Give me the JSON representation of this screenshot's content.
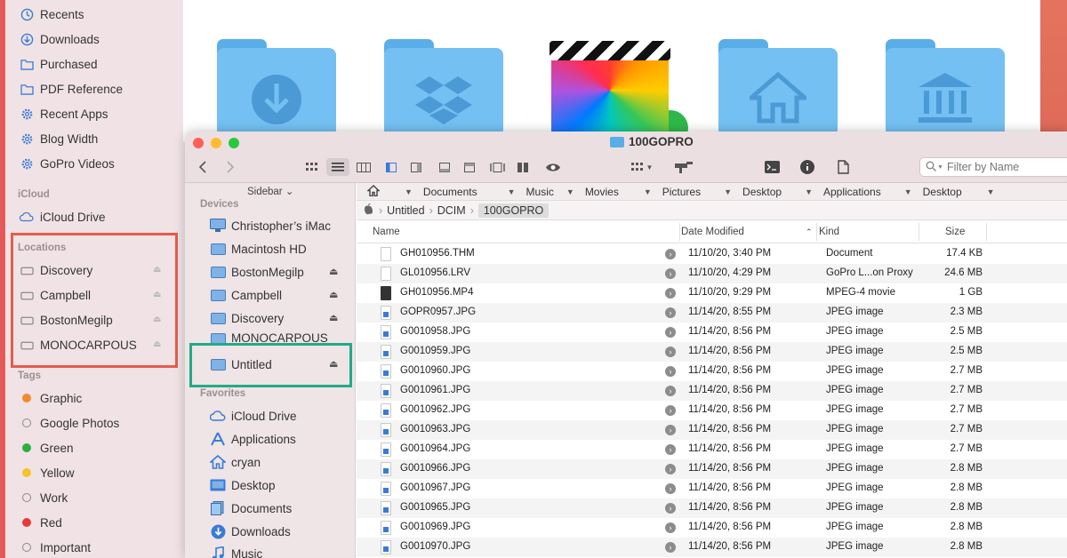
{
  "back_sidebar": {
    "items_top": [
      {
        "label": "Recents",
        "icon": "clock-icon"
      },
      {
        "label": "Downloads",
        "icon": "download-icon"
      },
      {
        "label": "Purchased",
        "icon": "folder-icon"
      },
      {
        "label": "PDF Reference",
        "icon": "folder-icon"
      },
      {
        "label": "Recent Apps",
        "icon": "gear-icon"
      },
      {
        "label": "Blog Width",
        "icon": "gear-icon"
      },
      {
        "label": "GoPro Videos",
        "icon": "gear-icon"
      }
    ],
    "icloud_heading": "iCloud",
    "icloud_drive": "iCloud Drive",
    "locations_heading": "Locations",
    "locations": [
      "Discovery",
      "Campbell",
      "BostonMegilp",
      "MONOCARPOUS"
    ],
    "tags_heading": "Tags",
    "tags": [
      {
        "label": "Graphic",
        "color": "#f28a2e"
      },
      {
        "label": "Google Photos",
        "color": "none"
      },
      {
        "label": "Green",
        "color": "#2bb040"
      },
      {
        "label": "Yellow",
        "color": "#f6c22a"
      },
      {
        "label": "Work",
        "color": "none"
      },
      {
        "label": "Red",
        "color": "#e63a3a"
      },
      {
        "label": "Important",
        "color": "none"
      }
    ]
  },
  "window": {
    "title": "100GOPRO",
    "filter_placeholder": "Filter by Name",
    "sidebar_toggle": "Sidebar ⌄",
    "devices_heading": "Devices",
    "devices": [
      {
        "label": "Christopher’s iMac",
        "eject": false
      },
      {
        "label": "Macintosh HD",
        "eject": false
      },
      {
        "label": "BostonMegilp",
        "eject": true
      },
      {
        "label": "Campbell",
        "eject": true
      },
      {
        "label": "Discovery",
        "eject": true
      },
      {
        "label": "MONOCARPOUS",
        "eject": false
      },
      {
        "label": "Untitled",
        "eject": true
      }
    ],
    "favorites_heading": "Favorites",
    "favorites": [
      {
        "label": "iCloud Drive",
        "icon": "cloud-icon"
      },
      {
        "label": "Applications",
        "icon": "applications-icon"
      },
      {
        "label": "cryan",
        "icon": "home-icon"
      },
      {
        "label": "Desktop",
        "icon": "desktop-icon"
      },
      {
        "label": "Documents",
        "icon": "documents-icon"
      },
      {
        "label": "Downloads",
        "icon": "download-icon"
      },
      {
        "label": "Music",
        "icon": "music-icon"
      }
    ],
    "pathbar": [
      "Documents",
      "Music",
      "Movies",
      "Pictures",
      "Desktop",
      "Applications",
      "Desktop"
    ],
    "breadcrumbs": [
      "Untitled",
      "DCIM",
      "100GOPRO"
    ],
    "columns": {
      "name": "Name",
      "date": "Date Modified",
      "kind": "Kind",
      "size": "Size"
    },
    "files": [
      {
        "name": "GH010956.THM",
        "date": "11/10/20, 3:40 PM",
        "kind": "Document",
        "size": "17.4 KB",
        "type": "doc"
      },
      {
        "name": "GL010956.LRV",
        "date": "11/10/20, 4:29 PM",
        "kind": "GoPro L...on Proxy",
        "size": "24.6 MB",
        "type": "doc"
      },
      {
        "name": "GH010956.MP4",
        "date": "11/10/20, 9:29 PM",
        "kind": "MPEG-4 movie",
        "size": "1 GB",
        "type": "mp4"
      },
      {
        "name": "GOPR0957.JPG",
        "date": "11/14/20, 8:55 PM",
        "kind": "JPEG image",
        "size": "2.3 MB",
        "type": "jpg"
      },
      {
        "name": "G0010958.JPG",
        "date": "11/14/20, 8:56 PM",
        "kind": "JPEG image",
        "size": "2.5 MB",
        "type": "jpg"
      },
      {
        "name": "G0010959.JPG",
        "date": "11/14/20, 8:56 PM",
        "kind": "JPEG image",
        "size": "2.5 MB",
        "type": "jpg"
      },
      {
        "name": "G0010960.JPG",
        "date": "11/14/20, 8:56 PM",
        "kind": "JPEG image",
        "size": "2.7 MB",
        "type": "jpg"
      },
      {
        "name": "G0010961.JPG",
        "date": "11/14/20, 8:56 PM",
        "kind": "JPEG image",
        "size": "2.7 MB",
        "type": "jpg"
      },
      {
        "name": "G0010962.JPG",
        "date": "11/14/20, 8:56 PM",
        "kind": "JPEG image",
        "size": "2.7 MB",
        "type": "jpg"
      },
      {
        "name": "G0010963.JPG",
        "date": "11/14/20, 8:56 PM",
        "kind": "JPEG image",
        "size": "2.7 MB",
        "type": "jpg"
      },
      {
        "name": "G0010964.JPG",
        "date": "11/14/20, 8:56 PM",
        "kind": "JPEG image",
        "size": "2.7 MB",
        "type": "jpg"
      },
      {
        "name": "G0010966.JPG",
        "date": "11/14/20, 8:56 PM",
        "kind": "JPEG image",
        "size": "2.8 MB",
        "type": "jpg"
      },
      {
        "name": "G0010967.JPG",
        "date": "11/14/20, 8:56 PM",
        "kind": "JPEG image",
        "size": "2.8 MB",
        "type": "jpg"
      },
      {
        "name": "G0010965.JPG",
        "date": "11/14/20, 8:56 PM",
        "kind": "JPEG image",
        "size": "2.8 MB",
        "type": "jpg"
      },
      {
        "name": "G0010969.JPG",
        "date": "11/14/20, 8:56 PM",
        "kind": "JPEG image",
        "size": "2.8 MB",
        "type": "jpg"
      },
      {
        "name": "G0010970.JPG",
        "date": "11/14/20, 8:56 PM",
        "kind": "JPEG image",
        "size": "2.8 MB",
        "type": "jpg"
      }
    ]
  },
  "colors": {
    "red_highlight": "#e55c4c",
    "green_highlight": "#22aa88",
    "accent_blue": "#5aaee8"
  }
}
